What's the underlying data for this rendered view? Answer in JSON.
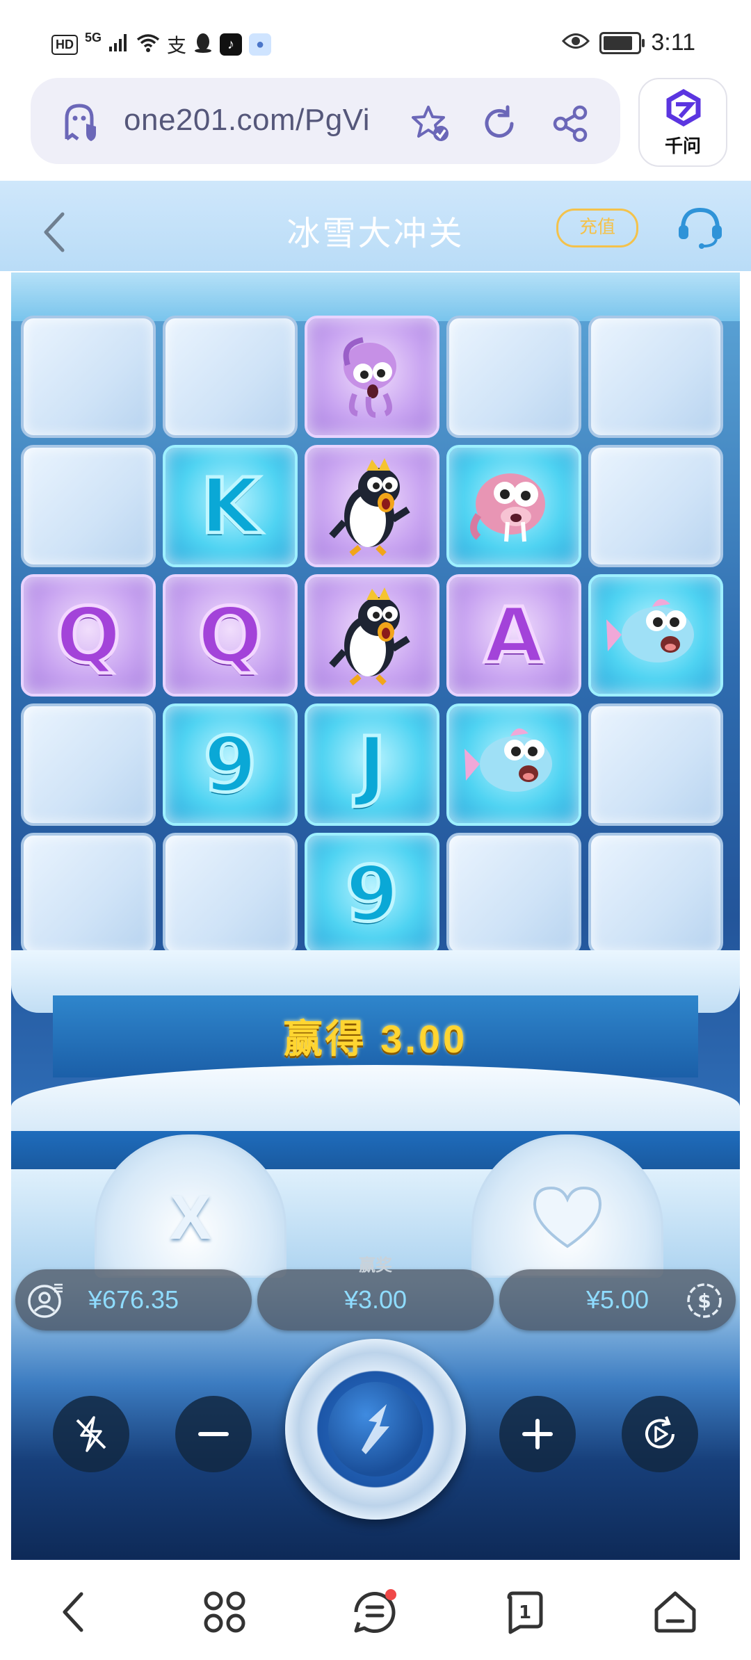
{
  "status_bar": {
    "hd_badge": "HD",
    "network": "5G",
    "alipay_glyph": "支",
    "time": "3:11",
    "battery_level": 0.85,
    "icons": [
      "signal-icon",
      "wifi-icon",
      "alipay-icon",
      "qq-icon",
      "tiktok-icon",
      "app-icon",
      "eye-icon",
      "battery-icon"
    ]
  },
  "browser": {
    "url": "one201.com/PgVi",
    "assistant_label": "千问",
    "icons": [
      "ghost-shield-icon",
      "star-check-icon",
      "refresh-icon",
      "share-icon",
      "qianwen-logo-icon"
    ]
  },
  "page_header": {
    "title": "冰雪大冲关",
    "recharge_label": "充值",
    "icons": [
      "back-chevron-icon",
      "headset-icon"
    ]
  },
  "game": {
    "grid_rows": [
      [
        {
          "type": "blank"
        },
        {
          "type": "blank"
        },
        {
          "type": "symbol",
          "symbol": "squid-icon",
          "color": "purple"
        },
        {
          "type": "blank"
        },
        {
          "type": "blank"
        }
      ],
      [
        {
          "type": "blank"
        },
        {
          "type": "letter",
          "text": "K",
          "color": "aqua"
        },
        {
          "type": "symbol",
          "symbol": "penguin-icon",
          "color": "purple"
        },
        {
          "type": "symbol",
          "symbol": "walrus-icon",
          "color": "aqua"
        },
        {
          "type": "blank"
        }
      ],
      [
        {
          "type": "letter",
          "text": "Q",
          "color": "purple"
        },
        {
          "type": "letter",
          "text": "Q",
          "color": "purple"
        },
        {
          "type": "symbol",
          "symbol": "penguin-icon",
          "color": "purple"
        },
        {
          "type": "letter",
          "text": "A",
          "color": "purple"
        },
        {
          "type": "symbol",
          "symbol": "fish-icon",
          "color": "aqua"
        }
      ],
      [
        {
          "type": "blank"
        },
        {
          "type": "letter",
          "text": "9",
          "color": "aqua"
        },
        {
          "type": "letter",
          "text": "J",
          "color": "aqua"
        },
        {
          "type": "symbol",
          "symbol": "fish-icon",
          "color": "aqua"
        },
        {
          "type": "blank"
        }
      ],
      [
        {
          "type": "blank"
        },
        {
          "type": "blank"
        },
        {
          "type": "letter",
          "text": "9",
          "color": "aqua"
        },
        {
          "type": "blank"
        },
        {
          "type": "blank"
        }
      ]
    ],
    "win_label": "赢得",
    "win_amount": "3.00",
    "igloo_left_mark": "X",
    "balance": "¥676.35",
    "win_pill_label": "赢奖",
    "win_pill_value": "¥3.00",
    "bet": "¥5.00",
    "controls": [
      "turbo-off-icon",
      "minus-icon",
      "spin-icon",
      "plus-icon",
      "autoplay-icon"
    ]
  },
  "bottom_nav": {
    "items": [
      "back-icon",
      "apps-icon",
      "menu-icon",
      "tabs-icon",
      "home-icon"
    ],
    "tab_count": "1"
  }
}
